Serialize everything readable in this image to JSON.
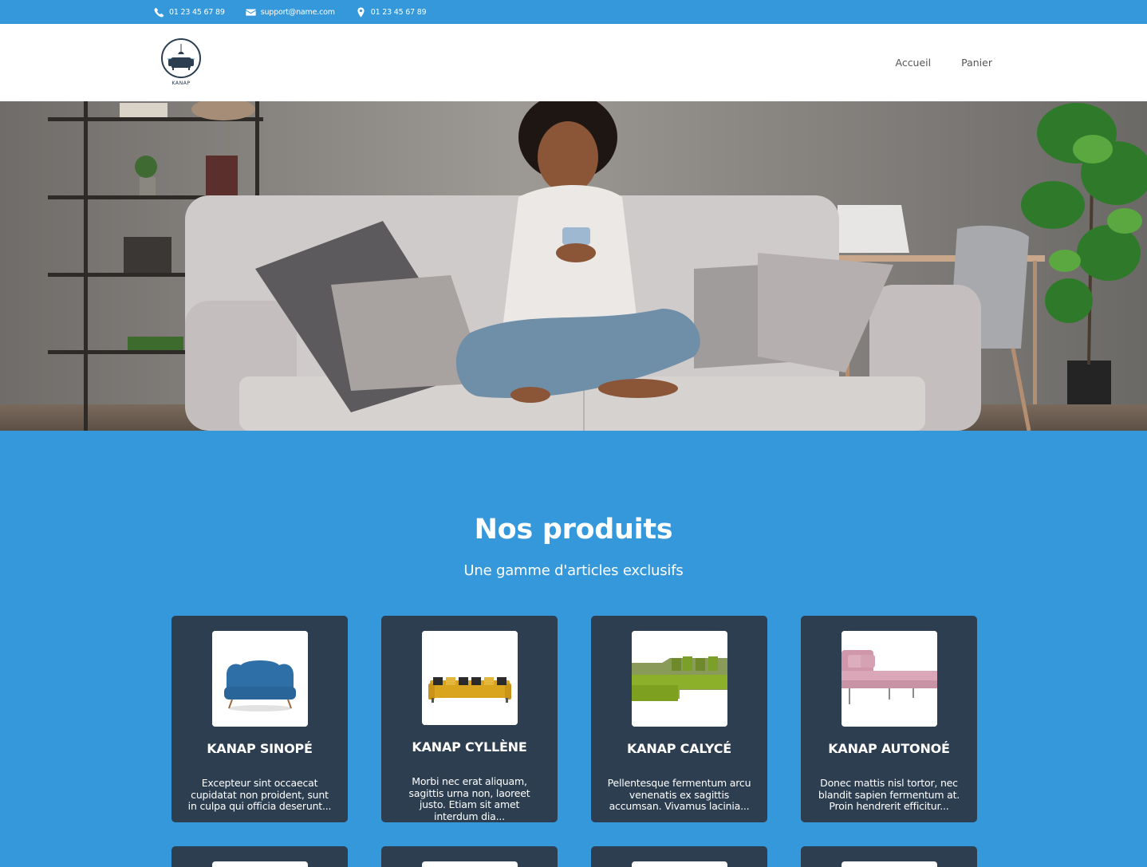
{
  "topbar": {
    "phone": "01 23 45 67 89",
    "email": "support@name.com",
    "location": "01 23 45 67 89"
  },
  "header": {
    "logo_text": "KANAP",
    "nav": {
      "home": "Accueil",
      "cart": "Panier"
    }
  },
  "products_section": {
    "title": "Nos produits",
    "subtitle": "Une gamme d'articles exclusifs",
    "items": [
      {
        "name": "KANAP SINOPÉ",
        "description": "Excepteur sint occaecat cupidatat non proident, sunt in culpa qui officia deserunt...",
        "color": "#2e6fa8"
      },
      {
        "name": "KANAP CYLLÈNE",
        "description": "Morbi nec erat aliquam, sagittis urna non, laoreet justo. Etiam sit amet interdum dia...",
        "color": "#d9a51f"
      },
      {
        "name": "KANAP CALYCÉ",
        "description": "Pellentesque fermentum arcu venenatis ex sagittis accumsan. Vivamus lacinia...",
        "color": "#8db02a"
      },
      {
        "name": "KANAP AUTONOÉ",
        "description": "Donec mattis nisl tortor, nec blandit sapien fermentum at. Proin hendrerit efficitur...",
        "color": "#d9a7b8"
      }
    ]
  },
  "colors": {
    "brand_blue": "#3498db",
    "card_bg": "#2c3e50"
  },
  "icons": [
    "phone-icon",
    "mail-icon",
    "location-pin-icon"
  ]
}
